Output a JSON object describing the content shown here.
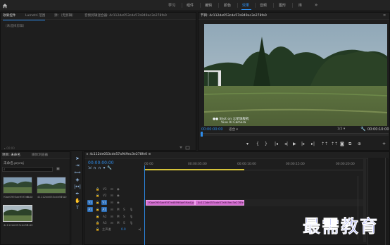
{
  "topbar": {
    "tabs": [
      "学习",
      "组件",
      "编辑",
      "颜色",
      "效果",
      "音频",
      "图形",
      "库"
    ],
    "active_tab": "效果",
    "more_icon": "double-chevron-right"
  },
  "effect_panel": {
    "tabs": [
      "效果控件",
      "Lumetri 范围",
      "源：（无剪辑）",
      "音频剪辑混合器: 4c112de053cde57a949ec3e278fe0"
    ],
    "active_tab": "效果控件",
    "no_clip_text": "（未选择剪辑）"
  },
  "program_panel": {
    "title": "节目: 4c112de053cde57a949ec3e278fe0",
    "timecode": "00:00:00:00",
    "fit_label": "适合",
    "resolution_label": "1/2",
    "duration": "00:00:10:00",
    "watermark": [
      "Shot on 三星旗舰机",
      "Vivo AI Camera"
    ]
  },
  "project_panel": {
    "tabs": [
      "项目: 未命名",
      "媒体浏览器"
    ],
    "project_file": "未命名.prproj",
    "items": [
      {
        "name": "f0ae0993ae95f7ed...",
        "dur": "5:00"
      },
      {
        "name": "41112de053cde57...",
        "dur": "5:00"
      },
      {
        "name": "4c112de053cde57...",
        "dur": "5:00"
      }
    ]
  },
  "timeline": {
    "title": "4c112de053cde57a949ec3e278fe0",
    "timecode": "00:00:00:00",
    "ruler": [
      "00:00",
      "00:00:05:00",
      "00:00:10:00",
      "00:00:15:00",
      "00:00:20:00"
    ],
    "tracks": [
      "V3",
      "V2",
      "V1",
      "A1",
      "A2",
      "A3",
      "主声道"
    ],
    "master_value": "0.0",
    "clips": [
      {
        "track": "V1",
        "label": "f0ae0993ae95f7ed8996ae59ad.jpg"
      },
      {
        "track": "V1",
        "label": "4c112de053cde57a949ec3e278fe0.jpg"
      }
    ]
  },
  "brand": "最需教育",
  "colors": {
    "accent": "#2d8ceb",
    "clip": "#d56fd2",
    "workarea": "#d5c33a",
    "brand": "#3d4ae0"
  }
}
